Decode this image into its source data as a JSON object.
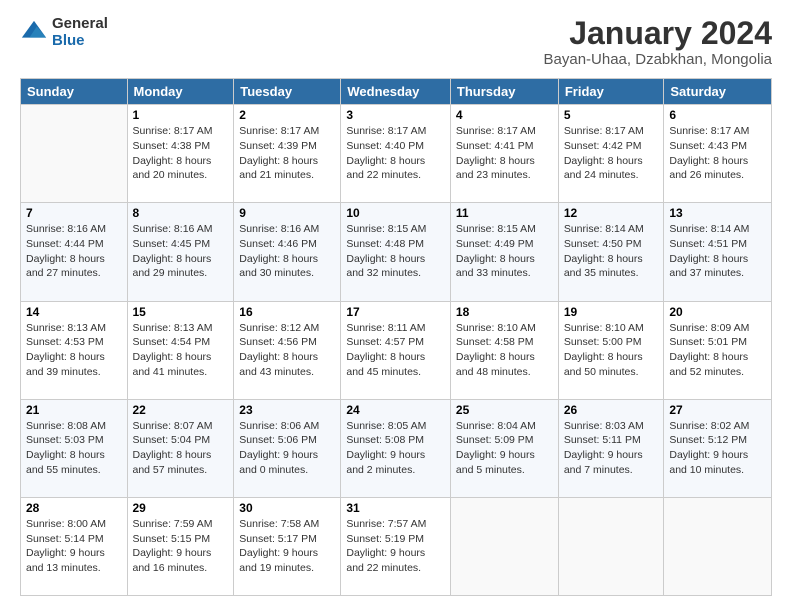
{
  "logo": {
    "general": "General",
    "blue": "Blue"
  },
  "header": {
    "title": "January 2024",
    "subtitle": "Bayan-Uhaa, Dzabkhan, Mongolia"
  },
  "days_of_week": [
    "Sunday",
    "Monday",
    "Tuesday",
    "Wednesday",
    "Thursday",
    "Friday",
    "Saturday"
  ],
  "weeks": [
    [
      {
        "day": "",
        "sunrise": "",
        "sunset": "",
        "daylight": ""
      },
      {
        "day": "1",
        "sunrise": "Sunrise: 8:17 AM",
        "sunset": "Sunset: 4:38 PM",
        "daylight": "Daylight: 8 hours and 20 minutes."
      },
      {
        "day": "2",
        "sunrise": "Sunrise: 8:17 AM",
        "sunset": "Sunset: 4:39 PM",
        "daylight": "Daylight: 8 hours and 21 minutes."
      },
      {
        "day": "3",
        "sunrise": "Sunrise: 8:17 AM",
        "sunset": "Sunset: 4:40 PM",
        "daylight": "Daylight: 8 hours and 22 minutes."
      },
      {
        "day": "4",
        "sunrise": "Sunrise: 8:17 AM",
        "sunset": "Sunset: 4:41 PM",
        "daylight": "Daylight: 8 hours and 23 minutes."
      },
      {
        "day": "5",
        "sunrise": "Sunrise: 8:17 AM",
        "sunset": "Sunset: 4:42 PM",
        "daylight": "Daylight: 8 hours and 24 minutes."
      },
      {
        "day": "6",
        "sunrise": "Sunrise: 8:17 AM",
        "sunset": "Sunset: 4:43 PM",
        "daylight": "Daylight: 8 hours and 26 minutes."
      }
    ],
    [
      {
        "day": "7",
        "sunrise": "Sunrise: 8:16 AM",
        "sunset": "Sunset: 4:44 PM",
        "daylight": "Daylight: 8 hours and 27 minutes."
      },
      {
        "day": "8",
        "sunrise": "Sunrise: 8:16 AM",
        "sunset": "Sunset: 4:45 PM",
        "daylight": "Daylight: 8 hours and 29 minutes."
      },
      {
        "day": "9",
        "sunrise": "Sunrise: 8:16 AM",
        "sunset": "Sunset: 4:46 PM",
        "daylight": "Daylight: 8 hours and 30 minutes."
      },
      {
        "day": "10",
        "sunrise": "Sunrise: 8:15 AM",
        "sunset": "Sunset: 4:48 PM",
        "daylight": "Daylight: 8 hours and 32 minutes."
      },
      {
        "day": "11",
        "sunrise": "Sunrise: 8:15 AM",
        "sunset": "Sunset: 4:49 PM",
        "daylight": "Daylight: 8 hours and 33 minutes."
      },
      {
        "day": "12",
        "sunrise": "Sunrise: 8:14 AM",
        "sunset": "Sunset: 4:50 PM",
        "daylight": "Daylight: 8 hours and 35 minutes."
      },
      {
        "day": "13",
        "sunrise": "Sunrise: 8:14 AM",
        "sunset": "Sunset: 4:51 PM",
        "daylight": "Daylight: 8 hours and 37 minutes."
      }
    ],
    [
      {
        "day": "14",
        "sunrise": "Sunrise: 8:13 AM",
        "sunset": "Sunset: 4:53 PM",
        "daylight": "Daylight: 8 hours and 39 minutes."
      },
      {
        "day": "15",
        "sunrise": "Sunrise: 8:13 AM",
        "sunset": "Sunset: 4:54 PM",
        "daylight": "Daylight: 8 hours and 41 minutes."
      },
      {
        "day": "16",
        "sunrise": "Sunrise: 8:12 AM",
        "sunset": "Sunset: 4:56 PM",
        "daylight": "Daylight: 8 hours and 43 minutes."
      },
      {
        "day": "17",
        "sunrise": "Sunrise: 8:11 AM",
        "sunset": "Sunset: 4:57 PM",
        "daylight": "Daylight: 8 hours and 45 minutes."
      },
      {
        "day": "18",
        "sunrise": "Sunrise: 8:10 AM",
        "sunset": "Sunset: 4:58 PM",
        "daylight": "Daylight: 8 hours and 48 minutes."
      },
      {
        "day": "19",
        "sunrise": "Sunrise: 8:10 AM",
        "sunset": "Sunset: 5:00 PM",
        "daylight": "Daylight: 8 hours and 50 minutes."
      },
      {
        "day": "20",
        "sunrise": "Sunrise: 8:09 AM",
        "sunset": "Sunset: 5:01 PM",
        "daylight": "Daylight: 8 hours and 52 minutes."
      }
    ],
    [
      {
        "day": "21",
        "sunrise": "Sunrise: 8:08 AM",
        "sunset": "Sunset: 5:03 PM",
        "daylight": "Daylight: 8 hours and 55 minutes."
      },
      {
        "day": "22",
        "sunrise": "Sunrise: 8:07 AM",
        "sunset": "Sunset: 5:04 PM",
        "daylight": "Daylight: 8 hours and 57 minutes."
      },
      {
        "day": "23",
        "sunrise": "Sunrise: 8:06 AM",
        "sunset": "Sunset: 5:06 PM",
        "daylight": "Daylight: 9 hours and 0 minutes."
      },
      {
        "day": "24",
        "sunrise": "Sunrise: 8:05 AM",
        "sunset": "Sunset: 5:08 PM",
        "daylight": "Daylight: 9 hours and 2 minutes."
      },
      {
        "day": "25",
        "sunrise": "Sunrise: 8:04 AM",
        "sunset": "Sunset: 5:09 PM",
        "daylight": "Daylight: 9 hours and 5 minutes."
      },
      {
        "day": "26",
        "sunrise": "Sunrise: 8:03 AM",
        "sunset": "Sunset: 5:11 PM",
        "daylight": "Daylight: 9 hours and 7 minutes."
      },
      {
        "day": "27",
        "sunrise": "Sunrise: 8:02 AM",
        "sunset": "Sunset: 5:12 PM",
        "daylight": "Daylight: 9 hours and 10 minutes."
      }
    ],
    [
      {
        "day": "28",
        "sunrise": "Sunrise: 8:00 AM",
        "sunset": "Sunset: 5:14 PM",
        "daylight": "Daylight: 9 hours and 13 minutes."
      },
      {
        "day": "29",
        "sunrise": "Sunrise: 7:59 AM",
        "sunset": "Sunset: 5:15 PM",
        "daylight": "Daylight: 9 hours and 16 minutes."
      },
      {
        "day": "30",
        "sunrise": "Sunrise: 7:58 AM",
        "sunset": "Sunset: 5:17 PM",
        "daylight": "Daylight: 9 hours and 19 minutes."
      },
      {
        "day": "31",
        "sunrise": "Sunrise: 7:57 AM",
        "sunset": "Sunset: 5:19 PM",
        "daylight": "Daylight: 9 hours and 22 minutes."
      },
      {
        "day": "",
        "sunrise": "",
        "sunset": "",
        "daylight": ""
      },
      {
        "day": "",
        "sunrise": "",
        "sunset": "",
        "daylight": ""
      },
      {
        "day": "",
        "sunrise": "",
        "sunset": "",
        "daylight": ""
      }
    ]
  ]
}
